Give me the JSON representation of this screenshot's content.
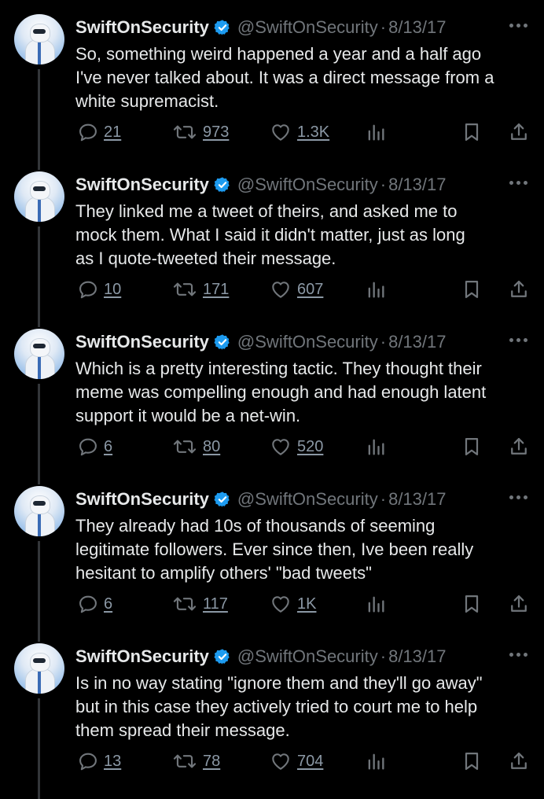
{
  "tweets": [
    {
      "name": "SwiftOnSecurity",
      "handle": "@SwiftOnSecurity",
      "date": "8/13/17",
      "lines": [
        "So, something weird happened a year and a half ago",
        "I've never talked about. It was a direct message from a",
        "white supremacist."
      ],
      "replies": "21",
      "retweets": "973",
      "likes": "1.3K"
    },
    {
      "name": "SwiftOnSecurity",
      "handle": "@SwiftOnSecurity",
      "date": "8/13/17",
      "lines": [
        "They linked me a tweet of theirs, and asked me to",
        "mock them. What I said it didn't matter, just as long",
        "as I quote-tweeted their message."
      ],
      "replies": "10",
      "retweets": "171",
      "likes": "607"
    },
    {
      "name": "SwiftOnSecurity",
      "handle": "@SwiftOnSecurity",
      "date": "8/13/17",
      "lines": [
        "Which is a pretty interesting tactic. They thought their",
        "meme was compelling enough and had enough latent",
        "support it would be a net-win."
      ],
      "replies": "6",
      "retweets": "80",
      "likes": "520"
    },
    {
      "name": "SwiftOnSecurity",
      "handle": "@SwiftOnSecurity",
      "date": "8/13/17",
      "lines": [
        "They already had 10s of thousands of seeming",
        "legitimate followers. Ever since then, Ive been really",
        "hesitant to amplify others' \"bad tweets\""
      ],
      "replies": "6",
      "retweets": "117",
      "likes": "1K"
    },
    {
      "name": "SwiftOnSecurity",
      "handle": "@SwiftOnSecurity",
      "date": "8/13/17",
      "lines": [
        "Is in no way stating \"ignore them and they'll go away\"",
        "but in this case they actively tried to court me to help",
        "them spread their message."
      ],
      "replies": "13",
      "retweets": "78",
      "likes": "704"
    }
  ],
  "icons": {
    "verified": "verified-badge-icon",
    "more": "more-options-icon",
    "reply": "reply-icon",
    "retweet": "retweet-icon",
    "like": "heart-icon",
    "views": "analytics-icon",
    "bookmark": "bookmark-icon",
    "share": "share-icon"
  },
  "colors": {
    "background": "#000000",
    "text": "#e7e9ea",
    "muted": "#71767b",
    "verified": "#1d9bf0",
    "thread_line": "#333639"
  }
}
